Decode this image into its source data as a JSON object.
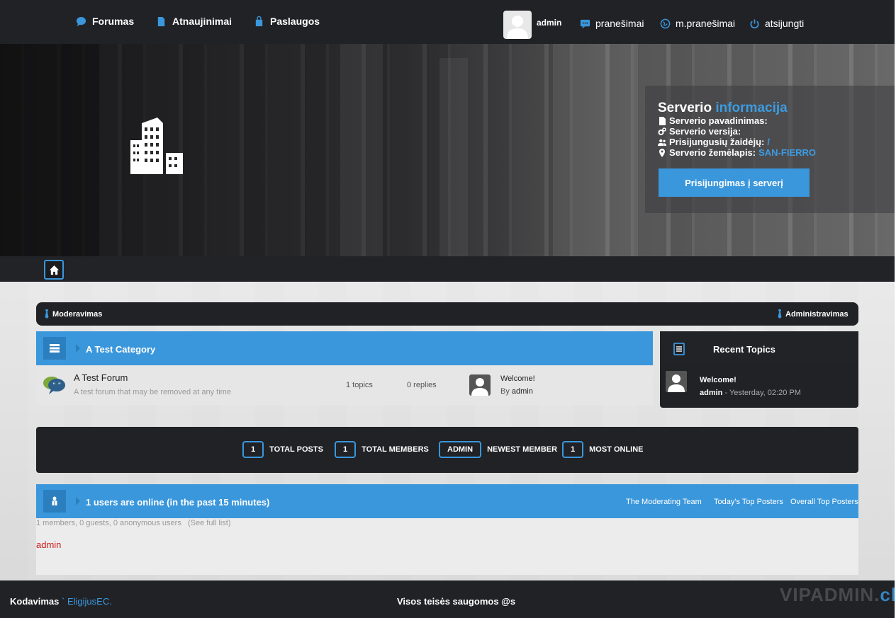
{
  "topnav": {
    "items": [
      {
        "label": "Forumas",
        "icon": "chat-bubble-icon"
      },
      {
        "label": "Atnaujinimai",
        "icon": "document-icon"
      },
      {
        "label": "Paslaugos",
        "icon": "bag-icon"
      }
    ],
    "user": {
      "name": "admin"
    },
    "notifications": "pranešimai",
    "messages": "m.pranešimai",
    "logout": "atsijungti"
  },
  "server": {
    "title_main": "Serverio",
    "title_accent": "informacija",
    "name_label": "Serverio pavadinimas:",
    "version_label": "Serverio versija:",
    "players_label": "Prisijungusių žaidėjų:",
    "players_value": "/",
    "map_label": "Serverio žemėlapis:",
    "map_value": "SAN-FIERRO",
    "connect_button": "Prisijungimas į serverį"
  },
  "modbar": {
    "left": "Moderavimas",
    "right": "Administravimas"
  },
  "category": {
    "title": "A Test Category",
    "forum": {
      "name": "A Test Forum",
      "description": "A test forum that may be removed at any time",
      "topics": "1 topics",
      "replies": "0 replies",
      "last_title": "Welcome!",
      "last_by_prefix": "By",
      "last_by_user": "admin"
    }
  },
  "recent": {
    "title": "Recent Topics",
    "topic": "Welcome!",
    "user": "admin",
    "time": " - Yesterday, 02:20 PM"
  },
  "stats": [
    {
      "value": "1",
      "label": "TOTAL POSTS"
    },
    {
      "value": "1",
      "label": "TOTAL MEMBERS"
    },
    {
      "value": "ADMIN",
      "label": "NEWEST MEMBER"
    },
    {
      "value": "1",
      "label": "MOST ONLINE"
    }
  ],
  "online": {
    "title": "1 users are online (in the past 15 minutes)",
    "links": [
      "The Moderating Team",
      "Today's Top Posters",
      "Overall Top Posters"
    ],
    "count": "1 members, 0 guests, 0 anonymous users",
    "full_list": "(See full list)",
    "user": "admin"
  },
  "footer": {
    "coding_label": "Kodavimas",
    "coding_sep": "`",
    "coding_author": "EligijusEC.",
    "rights": "Visos teisės saugomos @s",
    "watermark_main": "VIPADMIN.",
    "watermark_accent": "club"
  },
  "colors": {
    "accent": "#3a97dc",
    "dark": "#212226",
    "online_user": "#cc1a1a"
  }
}
